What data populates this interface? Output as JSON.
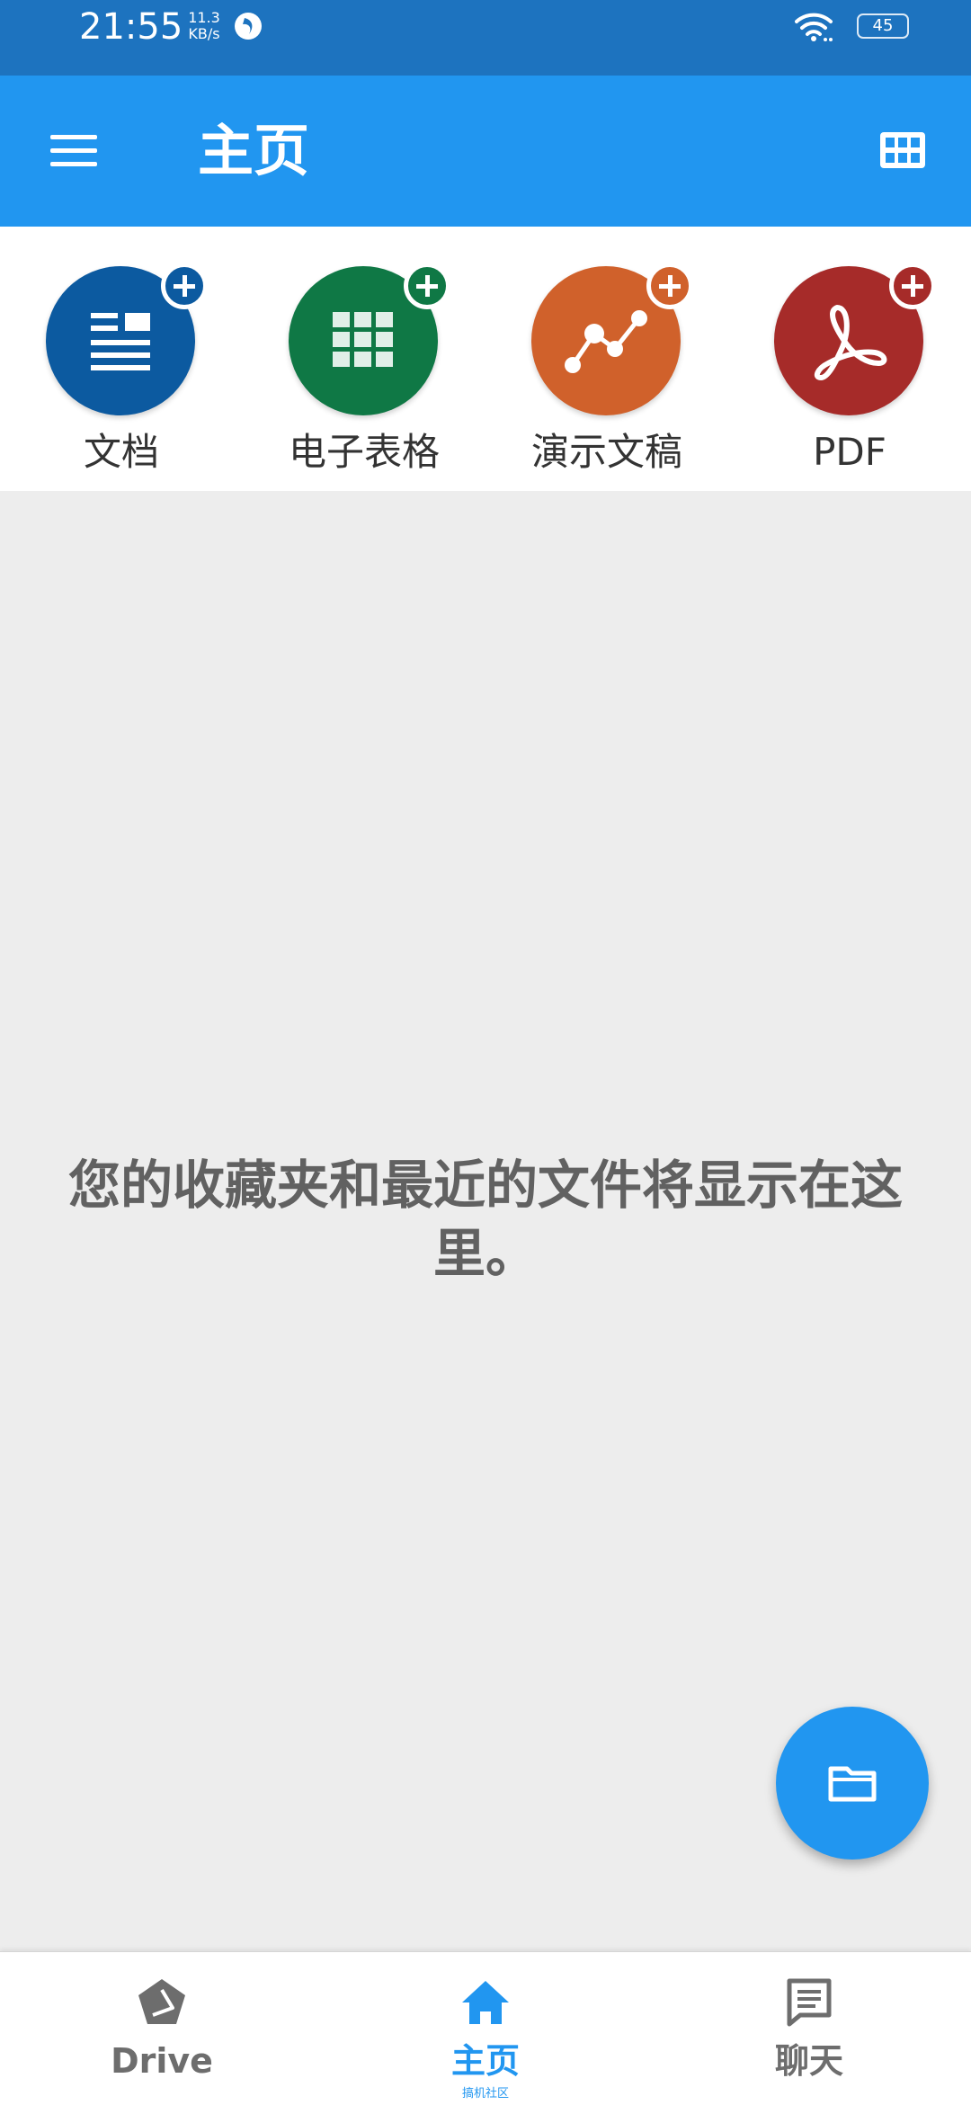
{
  "status_bar": {
    "time": "21:55",
    "net_speed_value": "11.3",
    "net_speed_unit": "KB/s",
    "battery": "45",
    "icons": [
      "app-notification-icon",
      "wifi-icon",
      "battery-icon"
    ]
  },
  "app_bar": {
    "title": "主页",
    "icons": [
      "menu-icon",
      "grid-view-icon"
    ]
  },
  "create": {
    "items": [
      {
        "label": "文档",
        "icon": "document-icon",
        "color": "#0c5aa0"
      },
      {
        "label": "电子表格",
        "icon": "spreadsheet-icon",
        "color": "#0f7845"
      },
      {
        "label": "演示文稿",
        "icon": "presentation-icon",
        "color": "#d0612b"
      },
      {
        "label": "PDF",
        "icon": "pdf-icon",
        "color": "#a62b29"
      }
    ],
    "badge_icon": "plus-icon"
  },
  "empty_state": {
    "message": "您的收藏夹和最近的文件将显示在这里。"
  },
  "fab": {
    "icon": "folder-icon",
    "color": "#2196f0"
  },
  "bottom_nav": {
    "items": [
      {
        "label": "Drive",
        "icon": "drive-icon",
        "active": false
      },
      {
        "label": "主页",
        "icon": "home-icon",
        "active": true
      },
      {
        "label": "聊天",
        "icon": "chat-icon",
        "active": false
      }
    ],
    "watermark": "搞机社区"
  },
  "colors": {
    "status_bar": "#1d73bf",
    "app_bar": "#2196f0",
    "background": "#ededed",
    "active_nav": "#2196f0",
    "inactive_nav": "#6d6d6d"
  }
}
